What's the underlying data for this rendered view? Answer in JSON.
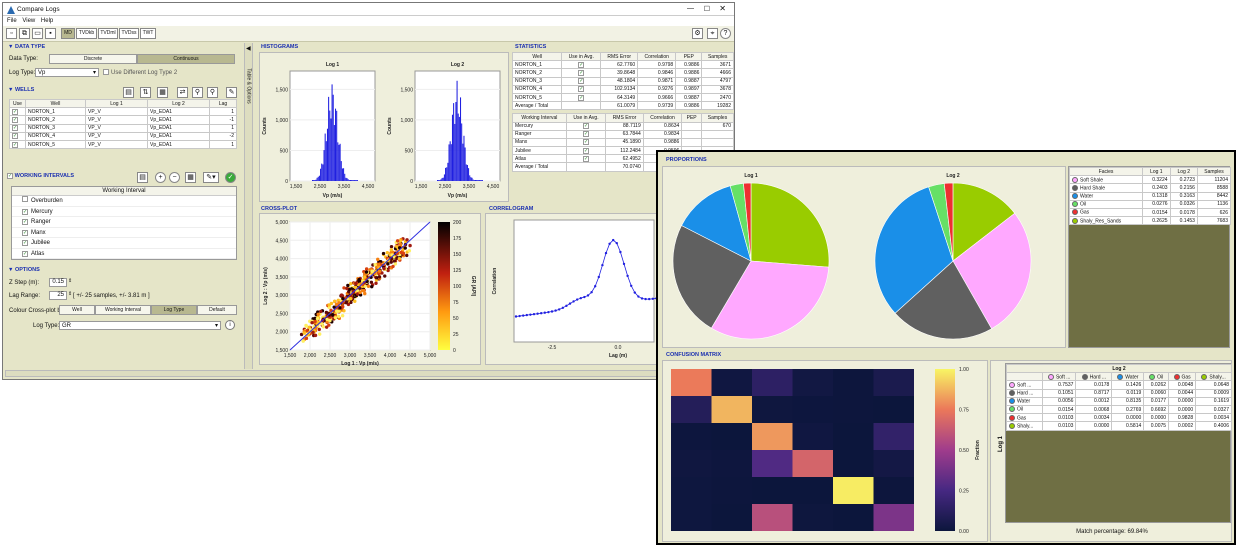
{
  "app": {
    "title": "Compare Logs",
    "menus": [
      "File",
      "View",
      "Help"
    ],
    "view_tabs": [
      "MD",
      "TVDkb",
      "TVDml",
      "TVDss",
      "TWT"
    ],
    "active_tab": "MD",
    "side_tab": "Table & Options"
  },
  "data_type": {
    "header": "DATA TYPE",
    "label": "Data Type:",
    "options": [
      "Discrete",
      "Continuous"
    ],
    "selected": "Continuous",
    "log_type_label": "Log Type:",
    "log_type_value": "Vp",
    "diff_label": "Use Different Log Type 2"
  },
  "wells": {
    "header": "WELLS",
    "columns": [
      "Use",
      "Well",
      "Log 1",
      "Log 2",
      "Lag"
    ],
    "rows": [
      {
        "well": "NORTON_1",
        "log1": "VP_V",
        "log2": "Vp_EDA1",
        "lag": "1"
      },
      {
        "well": "NORTON_2",
        "log1": "VP_V",
        "log2": "Vp_EDA1",
        "lag": "-1"
      },
      {
        "well": "NORTON_3",
        "log1": "VP_V",
        "log2": "Vp_EDA1",
        "lag": "1"
      },
      {
        "well": "NORTON_4",
        "log1": "VP_V",
        "log2": "Vp_EDA1",
        "lag": "-2"
      },
      {
        "well": "NORTON_5",
        "log1": "VP_V",
        "log2": "Vp_EDA1",
        "lag": "1"
      }
    ]
  },
  "intervals": {
    "header": "WORKING INTERVALS",
    "col": "Working Interval",
    "items": [
      {
        "name": "Overburden",
        "checked": false
      },
      {
        "name": "Mercury",
        "checked": true
      },
      {
        "name": "Ranger",
        "checked": true
      },
      {
        "name": "Manx",
        "checked": true
      },
      {
        "name": "Jubilee",
        "checked": true
      },
      {
        "name": "Atlas",
        "checked": true
      }
    ]
  },
  "options": {
    "header": "OPTIONS",
    "zstep_label": "Z Step (m):",
    "zstep": "0.15",
    "lag_label": "Lag Range:",
    "lag": "25",
    "lag_note": "[ +/- 25 samples, +/- 3.81 m ]",
    "colour_label": "Colour Cross-plot by:",
    "colour_opts": [
      "Well",
      "Working Interval",
      "Log Type",
      "Default"
    ],
    "colour_sel": "Log Type",
    "logtype_label": "Log Type:",
    "logtype": "GR"
  },
  "histograms": {
    "header": "HISTOGRAMS",
    "titles": [
      "Log 1",
      "Log 2"
    ],
    "ylabel": "Counts",
    "xlabel": "Vp (m/s)",
    "yticks": [
      "0",
      "500",
      "1,000",
      "1,500"
    ],
    "xticks": [
      "1,500",
      "2,500",
      "3,500",
      "4,500"
    ]
  },
  "statistics": {
    "header": "STATISTICS",
    "columns": [
      "Well",
      "Use in Avg.",
      "RMS Error",
      "Correlation",
      "PEP",
      "Samples"
    ],
    "rows": [
      [
        "NORTON_1",
        "62.7760",
        "0.9798",
        "0.9886",
        "3671"
      ],
      [
        "NORTON_2",
        "39.8648",
        "0.9846",
        "0.9886",
        "4666"
      ],
      [
        "NORTON_3",
        "48.1804",
        "0.9871",
        "0.9887",
        "4797"
      ],
      [
        "NORTON_4",
        "102.9134",
        "0.9276",
        "0.9897",
        "3678"
      ],
      [
        "NORTON_5",
        "64.3149",
        "0.9666",
        "0.9887",
        "2470"
      ]
    ],
    "total": [
      "Average / Total",
      "61.0079",
      "0.9739",
      "0.9886",
      "19282"
    ],
    "columns2": [
      "Working Interval",
      "Use in Avg.",
      "RMS Error",
      "Correlation",
      "PEP",
      "Samples"
    ],
    "rows2": [
      [
        "Mercury",
        "88.7119",
        "0.8634",
        "",
        "670"
      ],
      [
        "Ranger",
        "63.7844",
        "0.9834",
        "",
        ""
      ],
      [
        "Manx",
        "45.1890",
        "0.9886",
        "",
        ""
      ],
      [
        "Jubilee",
        "112.2484",
        "0.9596",
        "",
        ""
      ],
      [
        "Atlas",
        "62.4952",
        "0.9880",
        "",
        ""
      ]
    ],
    "total2": [
      "Average / Total",
      "70.0740",
      "0.9739",
      "",
      ""
    ]
  },
  "crossplot": {
    "header": "CROSS-PLOT",
    "xlabel": "Log 1 : Vp (m/s)",
    "ylabel": "Log 2 : Vp (m/s)",
    "cbar_label": "GR (API)",
    "xticks": [
      "1,500",
      "2,000",
      "2,500",
      "3,000",
      "3,500",
      "4,000",
      "4,500",
      "5,000"
    ],
    "yticks": [
      "1,500",
      "2,000",
      "2,500",
      "3,000",
      "3,500",
      "4,000",
      "4,500",
      "5,000"
    ],
    "cticks": [
      "0",
      "25",
      "50",
      "75",
      "100",
      "125",
      "150",
      "175",
      "200"
    ]
  },
  "correlogram": {
    "header": "CORRELOGRAM",
    "xlabel": "Lag (m)",
    "ylabel": "Correlation",
    "xticks": [
      "-2.5",
      "0.0"
    ]
  },
  "proportions": {
    "header": "PROPORTIONS",
    "titles": [
      "Log 1",
      "Log 2"
    ],
    "columns": [
      "Facies",
      "Log 1",
      "Log 2",
      "Samples"
    ],
    "rows": [
      {
        "name": "Soft Shale",
        "color": "#ffa8ff",
        "log1": "0.3224",
        "log2": "0.2723",
        "samples": "11204"
      },
      {
        "name": "Hard Shale",
        "color": "#606060",
        "log1": "0.2403",
        "log2": "0.2156",
        "samples": "8588"
      },
      {
        "name": "Water",
        "color": "#1a8fe8",
        "log1": "0.1318",
        "log2": "0.3163",
        "samples": "8442"
      },
      {
        "name": "Oil",
        "color": "#66e066",
        "log1": "0.0276",
        "log2": "0.0326",
        "samples": "1136"
      },
      {
        "name": "Gas",
        "color": "#ee3030",
        "log1": "0.0154",
        "log2": "0.0178",
        "samples": "626"
      },
      {
        "name": "Shaly_Res_Sands",
        "color": "#99cc00",
        "log1": "0.2625",
        "log2": "0.1453",
        "samples": "7683"
      }
    ]
  },
  "confusion": {
    "header": "CONFUSION MATRIX",
    "col_header": "Log 2",
    "row_header": "Log 1",
    "cbar_label": "Fraction",
    "cticks": [
      "0.00",
      "0.25",
      "0.50",
      "0.75",
      "1.00"
    ],
    "col_labels": [
      "Soft ...",
      "Hard ...",
      "Water",
      "Oil",
      "Gas",
      "Shaly..."
    ],
    "row_labels": [
      "Soft ...",
      "Hard ...",
      "Water",
      "Oil",
      "Gas",
      "Shaly..."
    ],
    "matrix": [
      [
        "0.7537",
        "0.0178",
        "0.1426",
        "0.0262",
        "0.0048",
        "0.0648"
      ],
      [
        "0.1051",
        "0.8717",
        "0.0119",
        "0.0060",
        "0.0044",
        "0.0009"
      ],
      [
        "0.0056",
        "0.0012",
        "0.8135",
        "0.0177",
        "0.0000",
        "0.1619"
      ],
      [
        "0.0154",
        "0.0068",
        "0.2769",
        "0.6692",
        "0.0000",
        "0.0327"
      ],
      [
        "0.0103",
        "0.0034",
        "0.0000",
        "0.0000",
        "0.9828",
        "0.0034"
      ],
      [
        "0.0103",
        "0.0000",
        "0.5814",
        "0.0075",
        "0.0002",
        "0.4006"
      ]
    ],
    "match": "Match percentage: 69.84%"
  }
}
